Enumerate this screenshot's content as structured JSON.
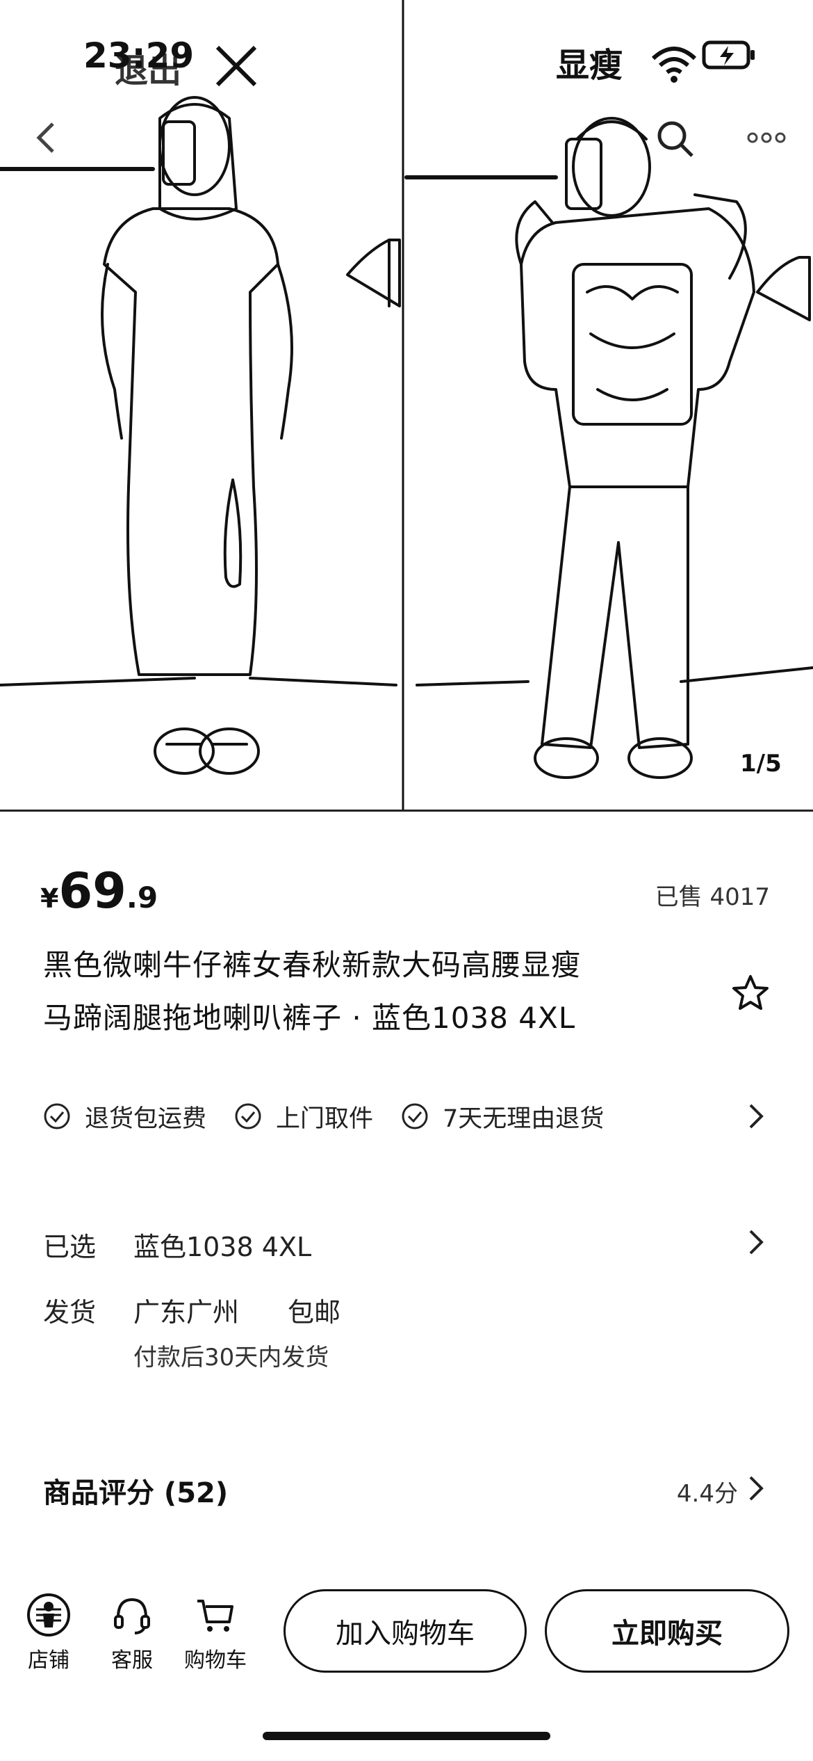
{
  "status_bar": {
    "time": "23:29",
    "left_overlay_text": "退出",
    "right_overlay_text": "显瘦"
  },
  "gallery": {
    "counter": "1/5"
  },
  "price": {
    "currency": "¥",
    "integer": "69",
    "decimal": ".9",
    "sold": "已售 4017"
  },
  "product": {
    "title_line1": "黑色微喇牛仔裤女春秋新款大码高腰显瘦",
    "title_line2": "马蹄阔腿拖地喇叭裤子 · 蓝色1038 4XL"
  },
  "services": [
    {
      "label": "退货包运费"
    },
    {
      "label": "上门取件"
    },
    {
      "label": "7天无理由退货"
    }
  ],
  "selection": {
    "label": "已选",
    "value": "蓝色1038 4XL"
  },
  "shipping": {
    "label": "发货",
    "origin": "广东广州",
    "fee": "包邮",
    "note": "付款后30天内发货"
  },
  "rating": {
    "title": "商品评分 (52)",
    "score": "4.4分"
  },
  "bottom_bar": {
    "store": "店铺",
    "service": "客服",
    "cart": "购物车",
    "add_to_cart": "加入购物车",
    "buy_now": "立即购买"
  },
  "icons": {
    "back": "chevron-left-icon",
    "search": "search-icon",
    "more": "more-icon",
    "favorite": "star-icon",
    "close": "close-icon"
  }
}
